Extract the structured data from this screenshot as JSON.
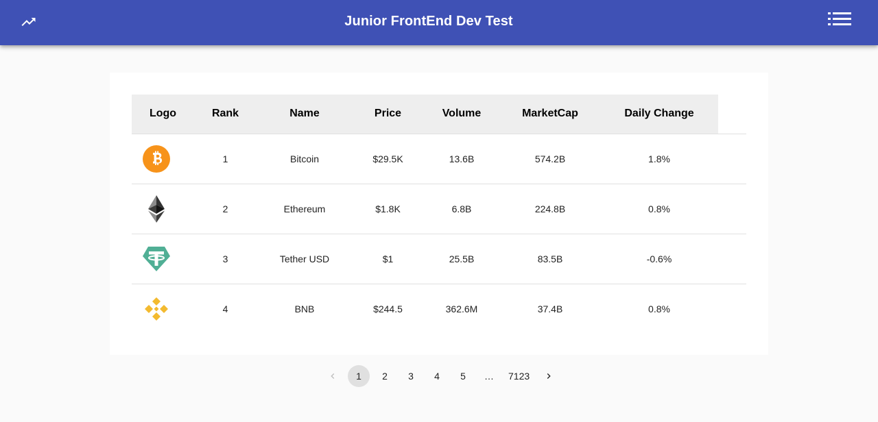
{
  "header": {
    "title": "Junior FrontEnd Dev Test",
    "left_icon": "trending-up-icon",
    "right_icon": "list-icon",
    "color": "#3f51b5"
  },
  "table": {
    "columns": [
      "Logo",
      "Rank",
      "Name",
      "Price",
      "Volume",
      "MarketCap",
      "Daily Change"
    ],
    "rows": [
      {
        "logo": "bitcoin-logo-icon",
        "rank": "1",
        "name": "Bitcoin",
        "price": "$29.5K",
        "volume": "13.6B",
        "marketcap": "574.2B",
        "change": "1.8%"
      },
      {
        "logo": "ethereum-logo-icon",
        "rank": "2",
        "name": "Ethereum",
        "price": "$1.8K",
        "volume": "6.8B",
        "marketcap": "224.8B",
        "change": "0.8%"
      },
      {
        "logo": "tether-logo-icon",
        "rank": "3",
        "name": "Tether USD",
        "price": "$1",
        "volume": "25.5B",
        "marketcap": "83.5B",
        "change": "-0.6%"
      },
      {
        "logo": "bnb-logo-icon",
        "rank": "4",
        "name": "BNB",
        "price": "$244.5",
        "volume": "362.6M",
        "marketcap": "37.4B",
        "change": "0.8%"
      }
    ]
  },
  "pagination": {
    "prev_icon": "chevron-left-icon",
    "next_icon": "chevron-right-icon",
    "pages": [
      "1",
      "2",
      "3",
      "4",
      "5"
    ],
    "ellipsis": "…",
    "last_page": "7123",
    "selected": "1"
  }
}
